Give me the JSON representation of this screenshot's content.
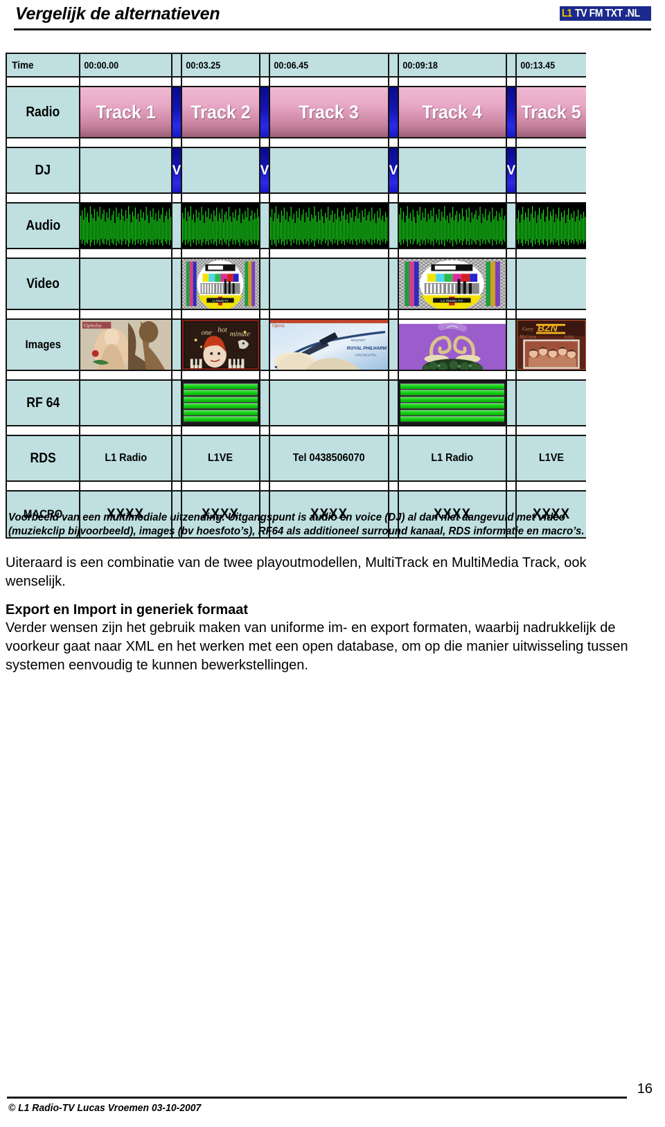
{
  "header": {
    "title": "Vergelijk de alternatieven",
    "logo": {
      "prefix": "L1",
      "text": "TV FM TXT .NL",
      "bg": "#1b2a8c",
      "prefix_color": "#f2c400",
      "text_color": "#ffffff"
    }
  },
  "timeline": {
    "time_label": "Time",
    "time_values": [
      "00:00.00",
      "00:03.25",
      "00:06.45",
      "00:09:18",
      "00:13.45"
    ],
    "rows": [
      {
        "label": "Radio",
        "values": [
          "Track 1",
          "Track 2",
          "Track 3",
          "Track 4",
          "Track 5"
        ]
      },
      {
        "label": "DJ",
        "marker": "V"
      },
      {
        "label": "Audio"
      },
      {
        "label": "Video"
      },
      {
        "label": "Images"
      },
      {
        "label": "RF 64"
      },
      {
        "label": "RDS",
        "values": [
          "L1 Radio",
          "L1VE",
          "Tel 0438506070",
          "L1 Radio",
          "L1VE"
        ]
      },
      {
        "label": "MACRO",
        "values": [
          "XXXX",
          "XXXX",
          "XXXX",
          "XXXX",
          "XXXX"
        ]
      }
    ],
    "colors": {
      "cell_bg": "#bfdfe0",
      "track_pink": "#e8a8c6",
      "track_dark": "#9d5f78",
      "gap_blue": "#1515b4",
      "waveform_green": "#18e018",
      "rf_green": "#15cc15",
      "grid": "#111111"
    }
  },
  "body": {
    "caption": "Voorbeeld van een multimediale uitzending. Uitgangspunt is audio en voice (DJ) al dan niet aangevuld met video (muziekclip bijvoorbeeld), images (bv hoesfoto’s), RF64 als additioneel surround kanaal, RDS informatie en macro’s.",
    "paragraph1": "Uiteraard is een combinatie van de twee playoutmodellen, MultiTrack en MultiMedia Track, ook wenselijk.",
    "subheading": "Export en Import in generiek formaat",
    "paragraph2": "Verder wensen zijn het gebruik maken van uniforme im- en export formaten, waarbij nadrukkelijk de voorkeur gaat naar XML en het werken met een open database, om op die manier uitwisseling tussen systemen eenvoudig te kunnen bewerkstellingen."
  },
  "footer": {
    "copyright": "© L1 Radio-TV Lucas Vroemen 03-10-2007",
    "page_number": "16"
  }
}
